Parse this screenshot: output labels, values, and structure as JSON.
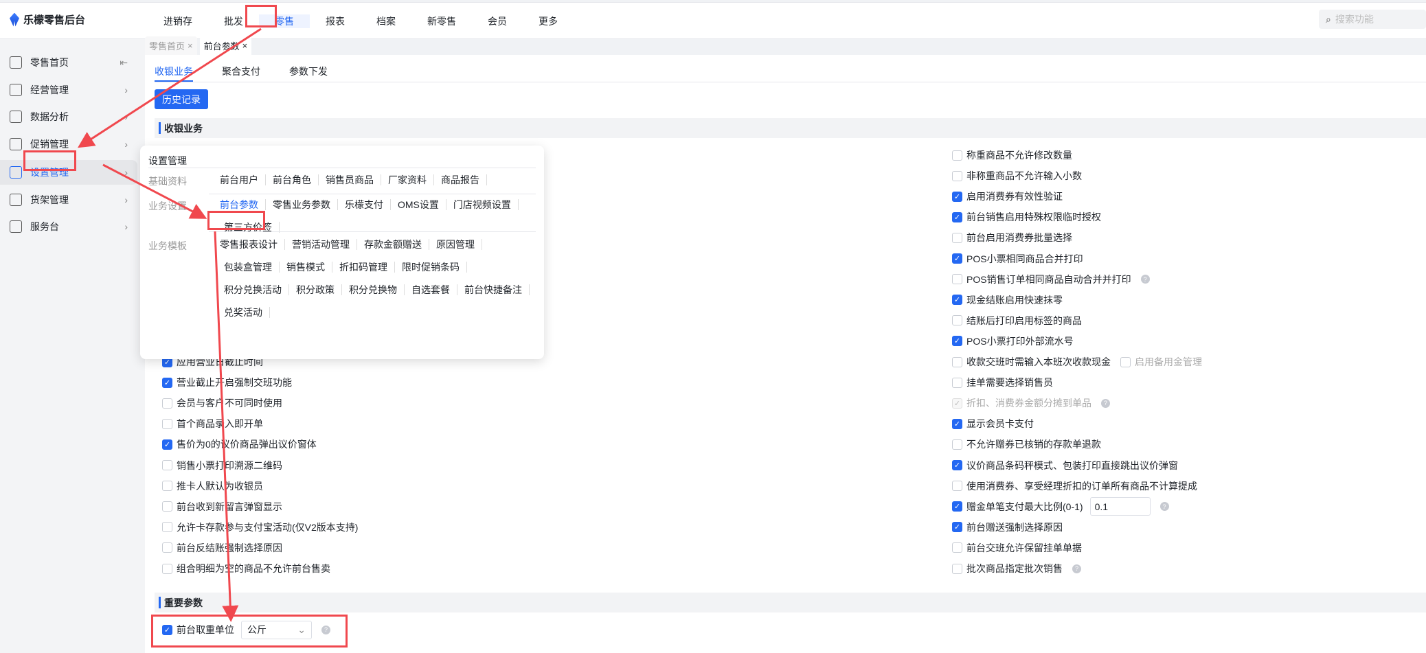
{
  "app": {
    "title": "乐檬零售后台"
  },
  "nav": [
    "进销存",
    "批发",
    "零售",
    "报表",
    "档案",
    "新零售",
    "会员",
    "更多"
  ],
  "search": {
    "placeholder": "搜索功能"
  },
  "sidebar": [
    {
      "label": "零售首页"
    },
    {
      "label": "经营管理"
    },
    {
      "label": "数据分析"
    },
    {
      "label": "促销管理"
    },
    {
      "label": "设置管理"
    },
    {
      "label": "货架管理"
    },
    {
      "label": "服务台"
    }
  ],
  "tabs": [
    {
      "label": "零售首页",
      "close": "×"
    },
    {
      "label": "前台参数",
      "close": "×"
    }
  ],
  "subtabs": [
    "收银业务",
    "聚合支付",
    "参数下发"
  ],
  "history_button": "历史记录",
  "sections": {
    "cashier": "收银业务",
    "important": "重要参数"
  },
  "left_options": [
    {
      "label": "应用营业日截止时间",
      "checked": true
    },
    {
      "label": "营业截止开启强制交班功能",
      "checked": true
    },
    {
      "label": "会员与客户不可同时使用",
      "checked": false
    },
    {
      "label": "首个商品录入即开单",
      "checked": false
    },
    {
      "label": "售价为0的议价商品弹出议价窗体",
      "checked": true
    },
    {
      "label": "销售小票打印溯源二维码",
      "checked": false
    },
    {
      "label": "推卡人默认为收银员",
      "checked": false
    },
    {
      "label": "前台收到新留言弹窗显示",
      "checked": false
    },
    {
      "label": "允许卡存款参与支付宝活动(仅V2版本支持)",
      "checked": false
    },
    {
      "label": "前台反结账强制选择原因",
      "checked": false
    },
    {
      "label": "组合明细为空的商品不允许前台售卖",
      "checked": false
    }
  ],
  "right_options": [
    {
      "label": "称重商品不允许修改数量",
      "checked": false
    },
    {
      "label": "非称重商品不允许输入小数",
      "checked": false
    },
    {
      "label": "启用消费券有效性验证",
      "checked": true
    },
    {
      "label": "前台销售启用特殊权限临时授权",
      "checked": true
    },
    {
      "label": "前台启用消费券批量选择",
      "checked": false
    },
    {
      "label": "POS小票相同商品合并打印",
      "checked": true
    },
    {
      "label": "POS销售订单相同商品自动合并并打印",
      "checked": false,
      "help": "?"
    },
    {
      "label": "现金结账启用快速抹零",
      "checked": true
    },
    {
      "label": "结账后打印启用标签的商品",
      "checked": false
    },
    {
      "label": "POS小票打印外部流水号",
      "checked": true
    },
    {
      "label": "收款交班时需输入本班次收款现金",
      "checked": false,
      "extra": "启用备用金管理"
    },
    {
      "label": "挂单需要选择销售员",
      "checked": false
    },
    {
      "label": "折扣、消费券金额分摊到单品",
      "checked": true,
      "disabled": true,
      "help": "?"
    },
    {
      "label": "显示会员卡支付",
      "checked": true
    },
    {
      "label": "不允许赠券已核销的存款单退款",
      "checked": false
    },
    {
      "label": "议价商品条码秤模式、包装打印直接跳出议价弹窗",
      "checked": true
    },
    {
      "label": "使用消费券、享受经理折扣的订单所有商品不计算提成",
      "checked": false
    },
    {
      "label": "赠金单笔支付最大比例(0-1)",
      "checked": true,
      "input": "0.1",
      "help": "?"
    },
    {
      "label": "前台赠送强制选择原因",
      "checked": true
    },
    {
      "label": "前台交班允许保留挂单单据",
      "checked": false
    },
    {
      "label": "批次商品指定批次销售",
      "checked": false,
      "help": "?"
    }
  ],
  "important": {
    "label": "前台取重单位",
    "checked": true,
    "value": "公斤",
    "help": "?"
  },
  "popup": {
    "title": "设置管理",
    "groups": [
      {
        "label": "基础资料",
        "links": [
          "前台用户",
          "前台角色",
          "销售员商品",
          "厂家资料",
          "商品报告"
        ]
      },
      {
        "label": "业务设置",
        "links": [
          "前台参数",
          "零售业务参数",
          "乐檬支付",
          "OMS设置",
          "门店视频设置",
          "第三方价签"
        ]
      },
      {
        "label": "业务模板",
        "links": [
          "零售报表设计",
          "营销活动管理",
          "存款金额赠送",
          "原因管理",
          "包装盒管理",
          "销售模式",
          "折扣码管理",
          "限时促销条码",
          "积分兑换活动",
          "积分政策",
          "积分兑换物",
          "自选套餐",
          "前台快捷备注",
          "兑奖活动"
        ]
      }
    ]
  },
  "colors": {
    "accent": "#2468f2",
    "annotation": "#f0484e"
  }
}
